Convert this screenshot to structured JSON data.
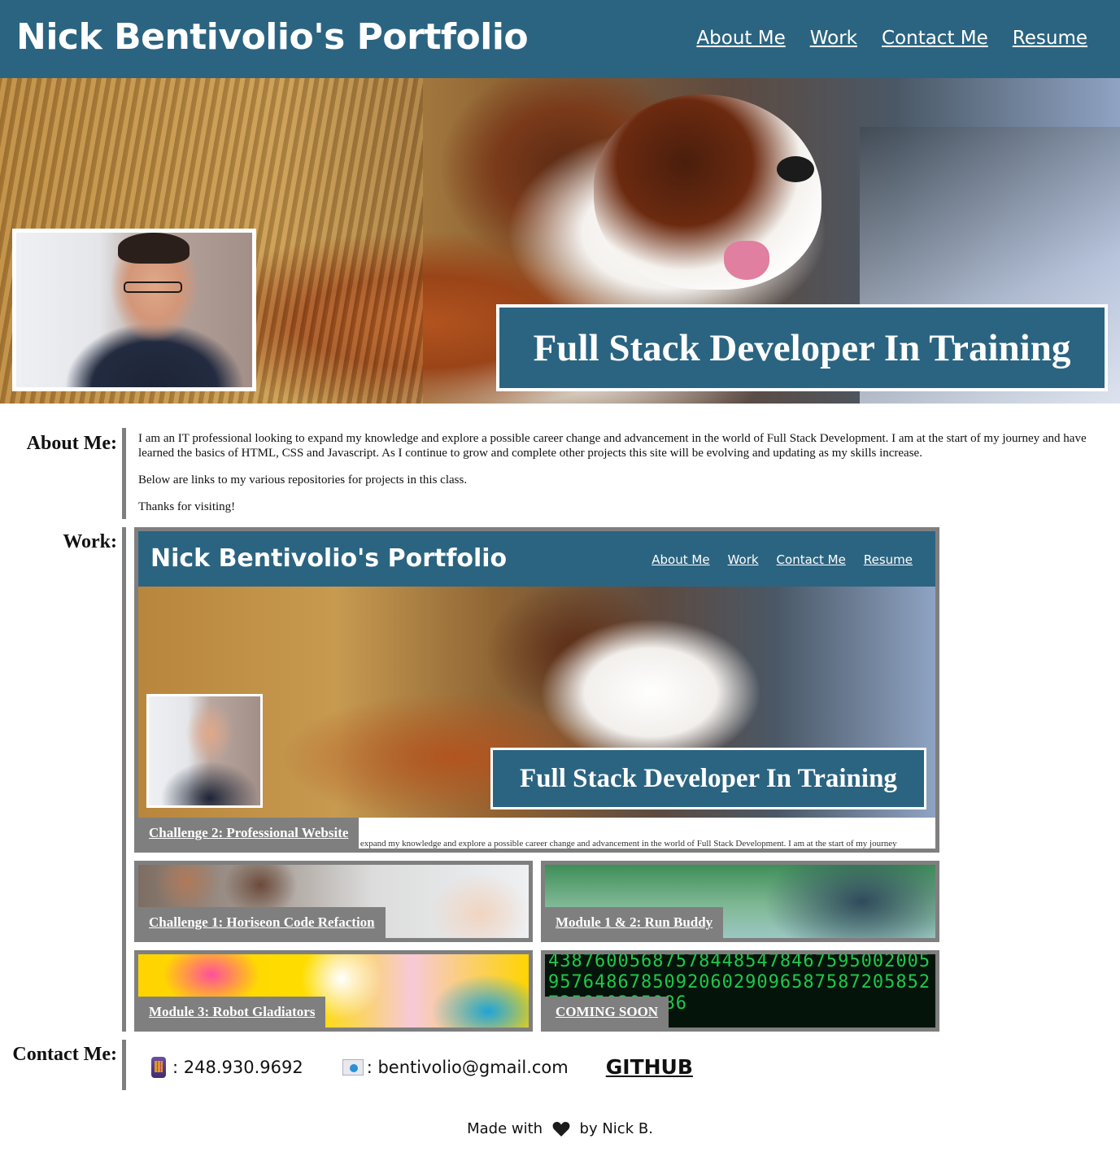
{
  "header": {
    "title": "Nick Bentivolio's Portfolio",
    "nav": [
      "About Me",
      "Work",
      "Contact Me",
      "Resume"
    ]
  },
  "hero": {
    "tagline": "Full Stack Developer In Training"
  },
  "about": {
    "label": "About Me:",
    "paragraphs": [
      "I am an IT professional looking to expand my knowledge and explore a possible career change and advancement in the world of Full Stack Development. I am at the start of my journey and have learned the basics of HTML, CSS and Javascript. As I continue to grow and complete other projects this site will be evolving and updating as my skills increase.",
      "Below are links to my various repositories for projects in this class.",
      "Thanks for visiting!"
    ]
  },
  "work": {
    "label": "Work:",
    "featured": {
      "label": "Challenge 2: Professional Website",
      "preview_title": "Nick Bentivolio's Portfolio",
      "preview_nav": [
        "About Me",
        "Work",
        "Contact Me",
        "Resume"
      ],
      "preview_tagline": "Full Stack Developer In Training",
      "preview_about": "I am an IT professional looking to expand my knowledge and explore a possible career change and advancement in the world of Full Stack Development. I am at the start of my journey"
    },
    "projects": [
      "Challenge 1: Horiseon Code Refaction",
      "Module 1 & 2: Run Buddy",
      "Module 3: Robot Gladiators",
      "COMING SOON"
    ]
  },
  "contact": {
    "label": "Contact Me:",
    "phone": ": 248.930.9692",
    "email": ": bentivolio@gmail.com",
    "github": "GITHUB"
  },
  "footer": {
    "prefix": "Made with",
    "suffix": "by Nick B."
  },
  "colors": {
    "brand": "#2b6481",
    "card_border": "#7f7f7f"
  }
}
